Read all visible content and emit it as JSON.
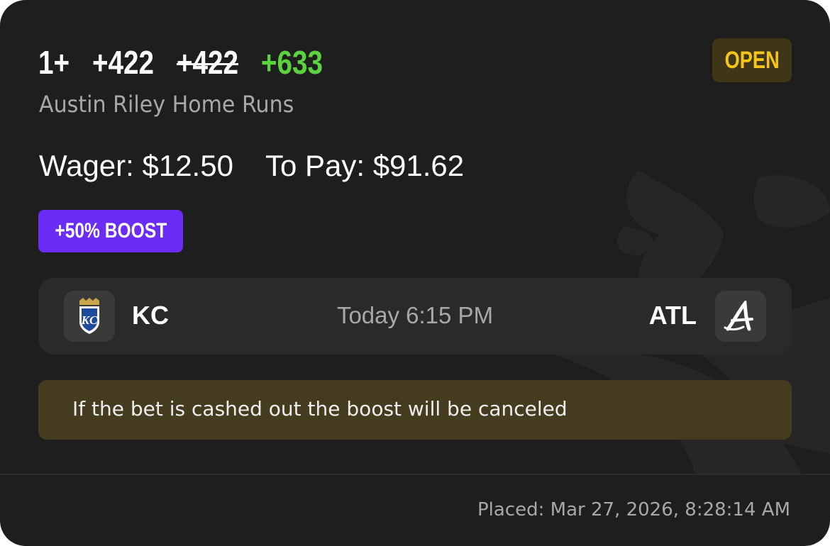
{
  "bet": {
    "selection": "1+",
    "original_odds": "+422",
    "struck_odds": "+422",
    "boosted_odds": "+633",
    "status": "OPEN",
    "market": "Austin Riley Home Runs",
    "wager_text": "Wager: $12.50",
    "to_pay_text": "To Pay: $91.62",
    "boost_label": "+50% BOOST"
  },
  "game": {
    "away_team": "KC",
    "home_team": "ATL",
    "time": "Today 6:15 PM",
    "away_logo_icon": "royals-kc-logo-icon",
    "home_logo_icon": "braves-a-logo-icon"
  },
  "notice": {
    "text": "If the bet is cashed out the boost will be canceled"
  },
  "footer": {
    "placed": "Placed: Mar 27, 2026, 8:28:14 AM"
  },
  "colors": {
    "card_bg": "#1e1e1e",
    "boosted_odds": "#5bd33f",
    "status_text": "#f5c518",
    "status_bg": "#3f3618",
    "boost_bg": "#6b2df5",
    "notice_bg": "#453b1e"
  }
}
